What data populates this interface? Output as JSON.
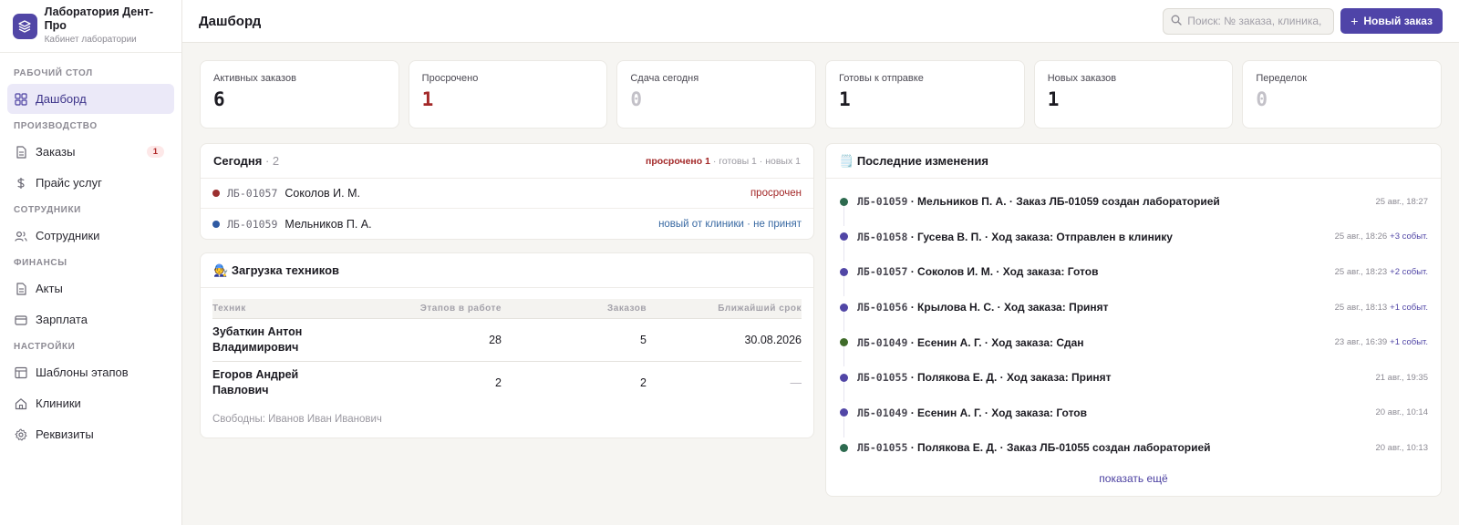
{
  "brand": {
    "name": "Лаборатория Дент-Про",
    "subtitle": "Кабинет лаборатории"
  },
  "sidebar": {
    "sections": [
      {
        "title": "Рабочий стол",
        "items": [
          {
            "label": "Дашборд",
            "icon": "grid-icon",
            "active": true
          }
        ]
      },
      {
        "title": "Производство",
        "items": [
          {
            "label": "Заказы",
            "icon": "document-icon",
            "badge": "1"
          },
          {
            "label": "Прайс услуг",
            "icon": "dollar-icon"
          }
        ]
      },
      {
        "title": "Сотрудники",
        "items": [
          {
            "label": "Сотрудники",
            "icon": "users-icon"
          }
        ]
      },
      {
        "title": "Финансы",
        "items": [
          {
            "label": "Акты",
            "icon": "document-icon"
          },
          {
            "label": "Зарплата",
            "icon": "card-icon"
          }
        ]
      },
      {
        "title": "Настройки",
        "items": [
          {
            "label": "Шаблоны этапов",
            "icon": "table-icon"
          },
          {
            "label": "Клиники",
            "icon": "home-icon"
          },
          {
            "label": "Реквизиты",
            "icon": "gear-icon"
          }
        ]
      }
    ]
  },
  "header": {
    "title": "Дашборд",
    "search_placeholder": "Поиск: № заказа, клиника, врач",
    "new_order_label": "Новый заказ"
  },
  "kpis": [
    {
      "label": "Активных заказов",
      "value": "6",
      "tone": "normal"
    },
    {
      "label": "Просрочено",
      "value": "1",
      "tone": "red"
    },
    {
      "label": "Сдача сегодня",
      "value": "0",
      "tone": "muted"
    },
    {
      "label": "Готовы к отправке",
      "value": "1",
      "tone": "normal"
    },
    {
      "label": "Новых заказов",
      "value": "1",
      "tone": "normal"
    },
    {
      "label": "Переделок",
      "value": "0",
      "tone": "muted"
    }
  ],
  "today": {
    "title": "Сегодня",
    "count": "2",
    "summary_overdue": "просрочено 1",
    "summary_rest": " · готовы 1 · новых 1",
    "rows": [
      {
        "code": "ЛБ-01057",
        "patient": "Соколов И. М.",
        "status": "просрочен",
        "status_tone": "red",
        "dot_color": "#9b2f2f"
      },
      {
        "code": "ЛБ-01059",
        "patient": "Мельников П. А.",
        "status": "новый от клиники · не принят",
        "status_tone": "blue",
        "dot_color": "#2f5aa3"
      }
    ]
  },
  "technicians": {
    "title": "Загрузка техников",
    "title_icon": "🧑‍🔧",
    "columns": [
      "Техник",
      "Этапов в работе",
      "Заказов",
      "Ближайший срок"
    ],
    "rows": [
      {
        "name": "Зубаткин Антон Владимирович",
        "stages": "28",
        "orders": "5",
        "deadline": "30.08.2026"
      },
      {
        "name": "Егоров Андрей Павлович",
        "stages": "2",
        "orders": "2",
        "deadline": "—"
      }
    ],
    "free_text": "Свободны: Иванов Иван Иванович"
  },
  "changes": {
    "title": "Последние изменения",
    "title_icon": "🗒️",
    "events": [
      {
        "code": "ЛБ-01059",
        "text": " · Мельников П. А. · Заказ ЛБ-01059 создан лабораторией",
        "time": "25 авг., 18:27",
        "more": "",
        "dot_color": "#2d6a4f"
      },
      {
        "code": "ЛБ-01058",
        "text": " · Гусева В. П. · Ход заказа: Отправлен в клинику",
        "time": "25 авг., 18:26",
        "more": "+3 событ.",
        "dot_color": "#5146a6"
      },
      {
        "code": "ЛБ-01057",
        "text": " · Соколов И. М. · Ход заказа: Готов",
        "time": "25 авг., 18:23",
        "more": "+2 событ.",
        "dot_color": "#5146a6"
      },
      {
        "code": "ЛБ-01056",
        "text": " · Крылова Н. С. · Ход заказа: Принят",
        "time": "25 авг., 18:13",
        "more": "+1 событ.",
        "dot_color": "#5146a6"
      },
      {
        "code": "ЛБ-01049",
        "text": " · Есенин А. Г. · Ход заказа: Сдан",
        "time": "23 авг., 16:39",
        "more": "+1 событ.",
        "dot_color": "#3f6b2a"
      },
      {
        "code": "ЛБ-01055",
        "text": " · Полякова Е. Д. · Ход заказа: Принят",
        "time": "21 авг., 19:35",
        "more": "",
        "dot_color": "#5146a6"
      },
      {
        "code": "ЛБ-01049",
        "text": " · Есенин А. Г. · Ход заказа: Готов",
        "time": "20 авг., 10:14",
        "more": "",
        "dot_color": "#5146a6"
      },
      {
        "code": "ЛБ-01055",
        "text": " · Полякова Е. Д. · Заказ ЛБ-01055 создан лабораторией",
        "time": "20 авг., 10:13",
        "more": "",
        "dot_color": "#2d6a4f"
      }
    ],
    "show_more_label": "показать ещё"
  },
  "colors": {
    "accent": "#4f44a8",
    "danger": "#a32828",
    "info": "#3a6aa3"
  }
}
